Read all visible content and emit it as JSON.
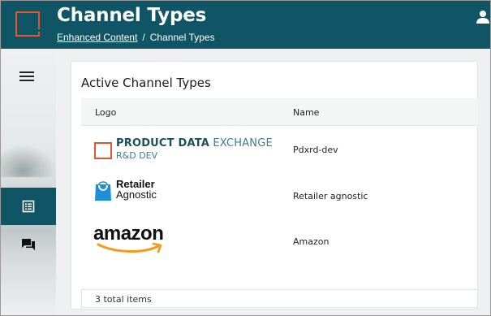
{
  "header": {
    "title": "Channel Types",
    "breadcrumb": {
      "link": "Enhanced Content",
      "separator": "/",
      "current": "Channel Types"
    }
  },
  "sidebar": {
    "items": [
      {
        "icon": "menu-icon"
      },
      {
        "icon": "list-icon",
        "active": true
      },
      {
        "icon": "chat-icon"
      }
    ]
  },
  "card": {
    "title": "Active Channel Types",
    "columns": [
      "Logo",
      "Name"
    ],
    "rows": [
      {
        "logo": {
          "line1_bold": "PRODUCT DATA",
          "line1_light": " EXCHANGE",
          "line2": "R&D DEV"
        },
        "name": "Pdxrd-dev"
      },
      {
        "logo": {
          "line1": "Retailer",
          "line2": "Agnostic"
        },
        "name": "Retailer agnostic"
      },
      {
        "logo": {
          "word": "amazon"
        },
        "name": "Amazon"
      }
    ],
    "footer": "3 total items"
  },
  "colors": {
    "header_bg": "#0f5565",
    "accent": "#e4572e",
    "main_bg": "#eef0f1"
  }
}
